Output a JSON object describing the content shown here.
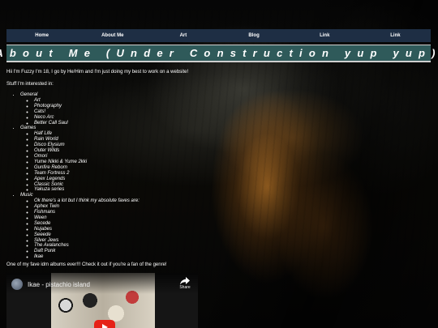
{
  "nav": {
    "items": [
      "Home",
      "About Me",
      "Art",
      "Blog",
      "Link",
      "Link"
    ]
  },
  "header": {
    "title": "About Me (Under Construction yup yup)"
  },
  "intro": {
    "text": "Hii I'm Fuzzy I'm 18, I go by He/Him and I'm just doing my best to work on a website!",
    "interests_heading": "Stuff I'm interested in:"
  },
  "interests": {
    "general": {
      "label": "General",
      "items": [
        "Art",
        "Photography",
        "Cats!",
        "Neco Arc",
        "Better Call Saul"
      ]
    },
    "games": {
      "label": "Games",
      "items": [
        "Half Life",
        "Rain World",
        "Disco Elysium",
        "Outer Wilds",
        "Omori",
        "Yume Nikki & Yume 2kki",
        "Gunfire Reborn",
        "Team Fortress 2",
        "Apex Legends",
        "Classic Sonic",
        "Yakuza series"
      ]
    },
    "music": {
      "label": "Music",
      "items": [
        "Ok there's a lot but I think my absolute faves are:",
        "Aphex Twin",
        "Fishmans",
        "Ween",
        "Secede",
        "Nujabes",
        "Seeede",
        "Silver Jews",
        "The Avalanches",
        "Daft Punk",
        "Ikae"
      ]
    }
  },
  "album": {
    "text": "One of my fave idm albums ever!!! Check it out if you're a fan of the genre!"
  },
  "video": {
    "title": "Ikae - pistachio island",
    "share_label": "Share"
  },
  "colors": {
    "navbar": "#1e2e44",
    "title_bar": "#2f5a5a",
    "text": "#ffffff"
  }
}
